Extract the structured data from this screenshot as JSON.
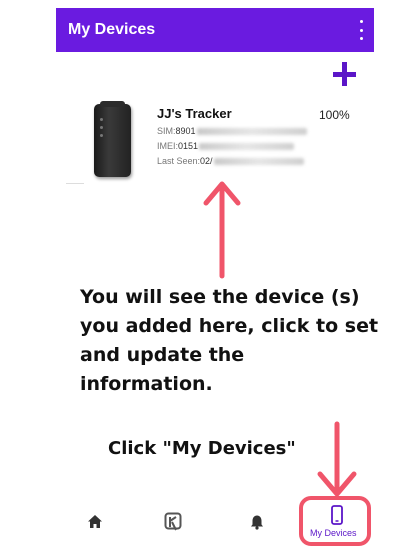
{
  "app_bar": {
    "title": "My Devices",
    "menu_icon": "more-vert-icon"
  },
  "actions": {
    "add_icon": "plus-icon"
  },
  "device": {
    "name": "JJ's Tracker",
    "battery": "100%",
    "sim_label": "SIM:",
    "sim_value": "8901",
    "imei_label": "IMEI:",
    "imei_value": "0151",
    "last_seen_label": "Last Seen:",
    "last_seen_value": "02/"
  },
  "annotation": {
    "instruction": "You will see the device (s) you added here, click to set and update the information.",
    "click_hint": "Click \"My Devices\"",
    "arrow_color": "#f0556a"
  },
  "bottom_nav": {
    "items": [
      {
        "icon": "home-icon",
        "label": ""
      },
      {
        "icon": "app-logo-icon",
        "label": ""
      },
      {
        "icon": "bell-icon",
        "label": ""
      },
      {
        "icon": "phone-icon",
        "label": "My Devices"
      }
    ],
    "active_color": "#5b16c8"
  },
  "colors": {
    "primary": "#6a1be0",
    "accent": "#5b16c8"
  }
}
